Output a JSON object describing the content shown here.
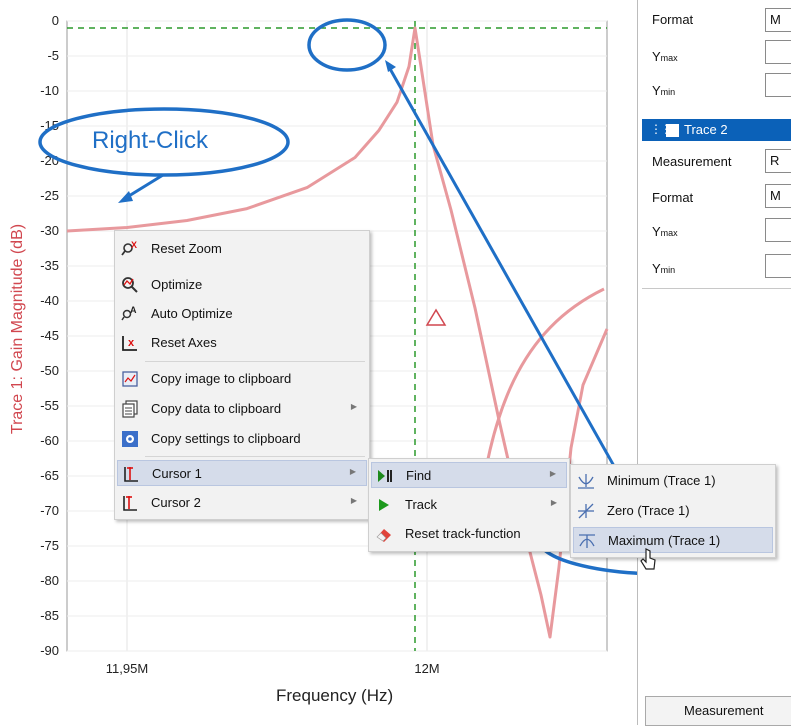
{
  "chart_data": {
    "type": "line",
    "xlabel": "Frequency (Hz)",
    "ylabel": "Trace 1: Gain Magnitude (dB)",
    "ylim": [
      -90,
      0
    ],
    "yticks": [
      0,
      -5,
      -10,
      -15,
      -20,
      -25,
      -30,
      -35,
      -40,
      -45,
      -50,
      -55,
      -60,
      -65,
      -70,
      -75,
      -80,
      -85,
      -90
    ],
    "ytick_labels": [
      "0",
      "-5",
      "-10",
      "-15",
      "-20",
      "-25",
      "-30",
      "-35",
      "-40",
      "-45",
      "-50",
      "-55",
      "-60",
      "-65",
      "-70",
      "-75",
      "-80",
      "-85",
      "-90"
    ],
    "xlim": [
      11.94,
      12.03
    ],
    "xtick_labels": [
      "11,95M",
      "12M"
    ],
    "xtick_values": [
      11.95,
      12.0
    ],
    "grid": true,
    "cursor_level": -1.0,
    "cursor_x": 11.998,
    "series": [
      {
        "color": "#e8999d",
        "x": [
          11.94,
          11.95,
          11.96,
          11.97,
          11.98,
          11.988,
          11.992,
          11.995,
          11.997,
          11.998,
          11.999,
          12.001,
          12.004,
          12.008,
          12.012,
          12.016,
          12.019,
          12.0205,
          12.022,
          12.024,
          12.026,
          12.03
        ],
        "y": [
          -30,
          -29.5,
          -28.5,
          -26.8,
          -23.8,
          -19.5,
          -15.6,
          -11.6,
          -6.5,
          -1.0,
          -6.5,
          -17.7,
          -27,
          -41,
          -57,
          -72,
          -82,
          -88,
          -78,
          -61,
          -52,
          -44
        ]
      }
    ]
  },
  "annotations": {
    "callout": "Right-Click",
    "marker_symbol": "triangle"
  },
  "context_menu": {
    "items": [
      {
        "label": "Reset Zoom",
        "icon": "reset-zoom-icon"
      },
      {
        "label": "Optimize",
        "icon": "optimize-icon"
      },
      {
        "label": "Auto Optimize",
        "icon": "auto-optimize-icon"
      },
      {
        "label": "Reset Axes",
        "icon": "reset-axes-icon"
      },
      {
        "label": "Copy image to clipboard",
        "icon": "copy-image-icon"
      },
      {
        "label": "Copy data to clipboard",
        "icon": "copy-data-icon"
      },
      {
        "label": "Copy settings to clipboard",
        "icon": "copy-settings-icon"
      },
      {
        "label": "Cursor 1",
        "icon": "cursor-icon"
      },
      {
        "label": "Cursor 2",
        "icon": "cursor-icon"
      }
    ]
  },
  "submenu": {
    "items": [
      {
        "label": "Find",
        "icon": "play-pause-icon"
      },
      {
        "label": "Track",
        "icon": "play-icon"
      },
      {
        "label": "Reset track-function",
        "icon": "eraser-icon"
      }
    ]
  },
  "find_menu": {
    "items": [
      {
        "label": "Minimum (Trace 1)",
        "icon": "minimum-icon"
      },
      {
        "label": "Zero (Trace 1)",
        "icon": "zero-icon"
      },
      {
        "label": "Maximum (Trace 1)",
        "icon": "maximum-icon"
      }
    ]
  },
  "side_panel": {
    "format_label": "Format",
    "format_value": "M",
    "ymax_label": "Y",
    "ymax_sub": "max",
    "ymin_label": "Y",
    "ymin_sub": "min",
    "trace2_label": "Trace 2",
    "measurement_label": "Measurement",
    "measurement_value": "R",
    "format2_label": "Format",
    "format2_value": "M",
    "ymax2_label": "Y",
    "ymax2_sub": "max",
    "ymin2_label": "Y",
    "ymin2_sub": "min",
    "bottom_button": "Measurement"
  },
  "colors": {
    "accent": "#0b61b8",
    "trace": "#e8999d",
    "cursor": "#2c9a2c",
    "callout": "#1f6fc6",
    "axis_title": "#d1474f"
  }
}
